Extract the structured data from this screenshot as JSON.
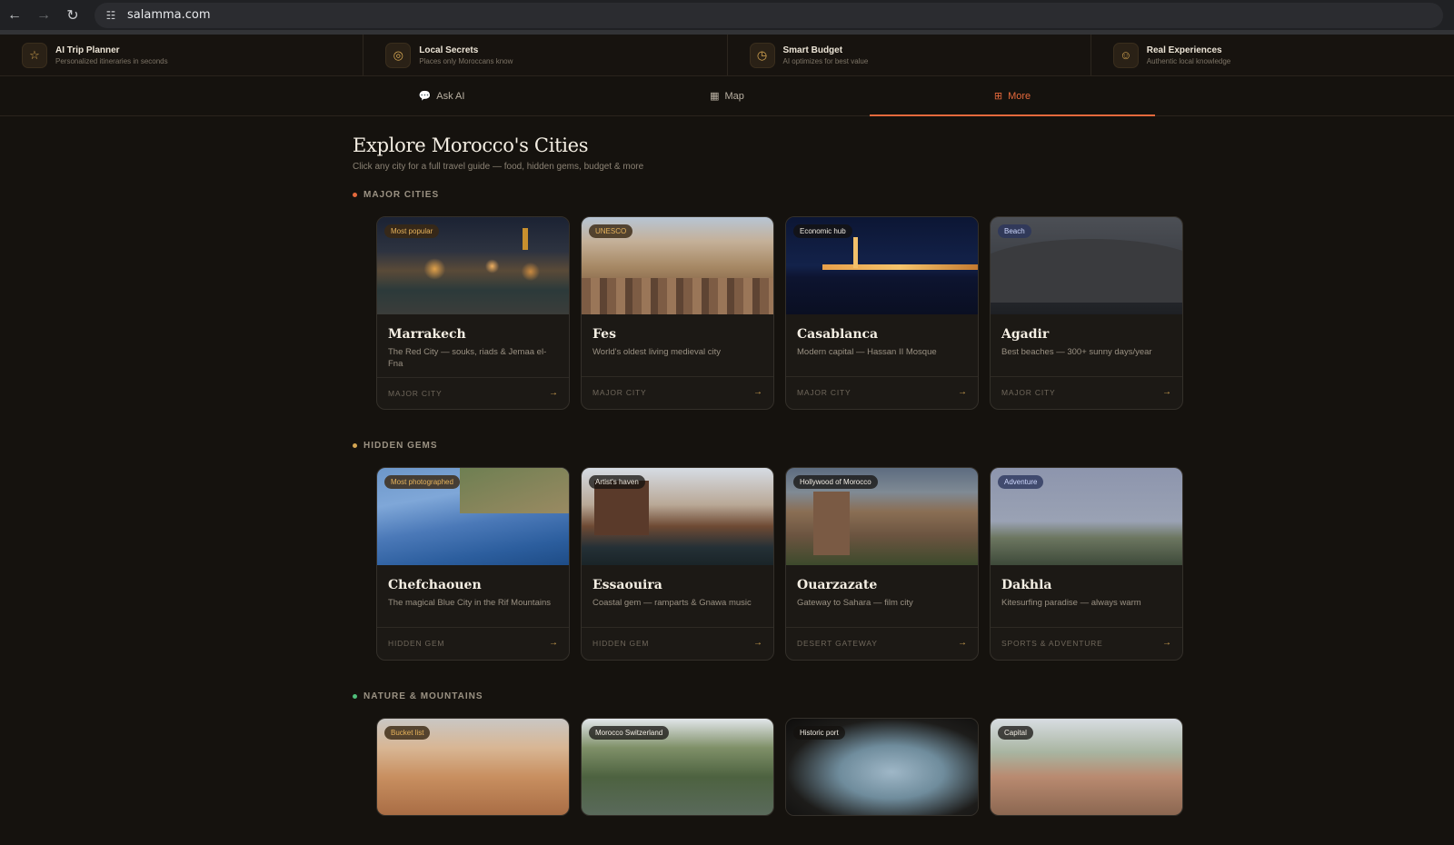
{
  "browser": {
    "url": "salamma.com"
  },
  "features": [
    {
      "icon": "star-icon",
      "title": "AI Trip Planner",
      "subtitle": "Personalized itineraries in seconds"
    },
    {
      "icon": "pin-icon",
      "title": "Local Secrets",
      "subtitle": "Places only Moroccans know"
    },
    {
      "icon": "clock-icon",
      "title": "Smart Budget",
      "subtitle": "AI optimizes for best value"
    },
    {
      "icon": "people-icon",
      "title": "Real Experiences",
      "subtitle": "Authentic local knowledge"
    }
  ],
  "tabs": [
    {
      "label": "Ask AI",
      "icon": "chat-icon"
    },
    {
      "label": "Map",
      "icon": "map-icon"
    },
    {
      "label": "More",
      "icon": "grid-icon",
      "active": true
    }
  ],
  "page": {
    "title": "Explore Morocco's Cities",
    "subtitle": "Click any city for a full travel guide — food, hidden gems, budget & more"
  },
  "sections": [
    {
      "title": "MAJOR CITIES",
      "dot_color": "#e4693c",
      "cards": [
        {
          "badge": "Most popular",
          "name": "Marrakech",
          "desc": "The Red City — souks, riads & Jemaa el-Fna",
          "tag": "MAJOR CITY"
        },
        {
          "badge": "UNESCO",
          "name": "Fes",
          "desc": "World's oldest living medieval city",
          "tag": "MAJOR CITY"
        },
        {
          "badge": "Economic hub",
          "name": "Casablanca",
          "desc": "Modern capital — Hassan II Mosque",
          "tag": "MAJOR CITY"
        },
        {
          "badge": "Beach",
          "name": "Agadir",
          "desc": "Best beaches — 300+ sunny days/year",
          "tag": "MAJOR CITY"
        }
      ]
    },
    {
      "title": "HIDDEN GEMS",
      "dot_color": "#d4a552",
      "cards": [
        {
          "badge": "Most photographed",
          "name": "Chefchaouen",
          "desc": "The magical Blue City in the Rif Mountains",
          "tag": "HIDDEN GEM"
        },
        {
          "badge": "Artist's haven",
          "name": "Essaouira",
          "desc": "Coastal gem — ramparts & Gnawa music",
          "tag": "HIDDEN GEM"
        },
        {
          "badge": "Hollywood of Morocco",
          "name": "Ouarzazate",
          "desc": "Gateway to Sahara — film city",
          "tag": "DESERT GATEWAY"
        },
        {
          "badge": "Adventure",
          "name": "Dakhla",
          "desc": "Kitesurfing paradise — always warm",
          "tag": "SPORTS & ADVENTURE"
        }
      ]
    },
    {
      "title": "NATURE & MOUNTAINS",
      "dot_color": "#4fbf7a",
      "cards": [
        {
          "badge": "Bucket list"
        },
        {
          "badge": "Morocco Switzerland"
        },
        {
          "badge": "Historic port"
        },
        {
          "badge": "Capital"
        }
      ]
    }
  ],
  "ui": {
    "arrow": "→"
  }
}
